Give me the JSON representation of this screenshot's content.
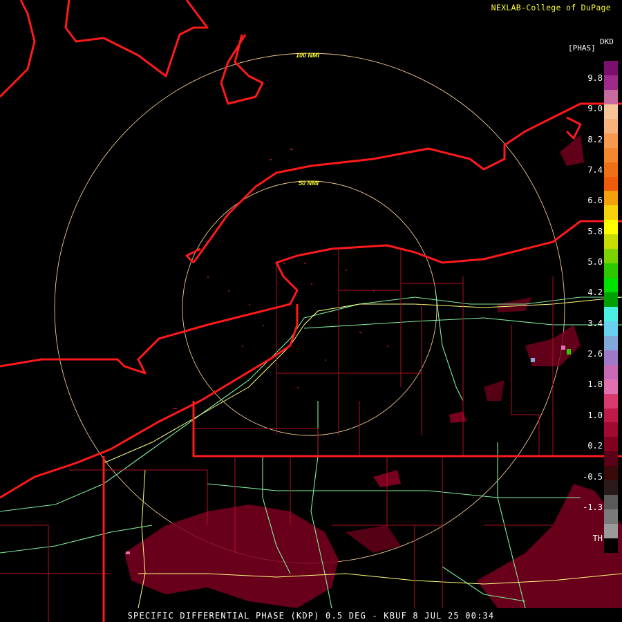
{
  "credit": "NEXLAB-College of DuPage",
  "units": "[PHAS]",
  "site_label": "DKD",
  "ring_labels": [
    "100 NMI",
    "50 NMI"
  ],
  "legend": {
    "labels": [
      "9.8",
      "9.0",
      "8.2",
      "7.4",
      "6.6",
      "5.8",
      "5.0",
      "4.2",
      "3.4",
      "2.6",
      "1.8",
      "1.0",
      "0.2",
      "-0.5",
      "-1.3",
      "TH"
    ],
    "colors": [
      "#7a0f6e",
      "#9e2a8a",
      "#c76aa0",
      "#f7c49a",
      "#f8b27a",
      "#f79a50",
      "#f3882e",
      "#ee7014",
      "#f05a0c",
      "#f3a00c",
      "#f8d20a",
      "#ffff00",
      "#c8dc00",
      "#7ad200",
      "#2ec800",
      "#00e000",
      "#00a000",
      "#4af0e0",
      "#6ad0f0",
      "#80a8d8",
      "#a078c8",
      "#c86ab8",
      "#e070b0",
      "#d83a70",
      "#c01a48",
      "#a00a30",
      "#800020",
      "#5a0018",
      "#3a0a0a",
      "#2a1a1a",
      "#5a5a5a",
      "#7a7a7a",
      "#9a9a9a",
      "#000000"
    ]
  },
  "caption": "SPECIFIC DIFFERENTIAL PHASE (KDP) 0.5 DEG - KBUF 8 JUL 25 00:34"
}
